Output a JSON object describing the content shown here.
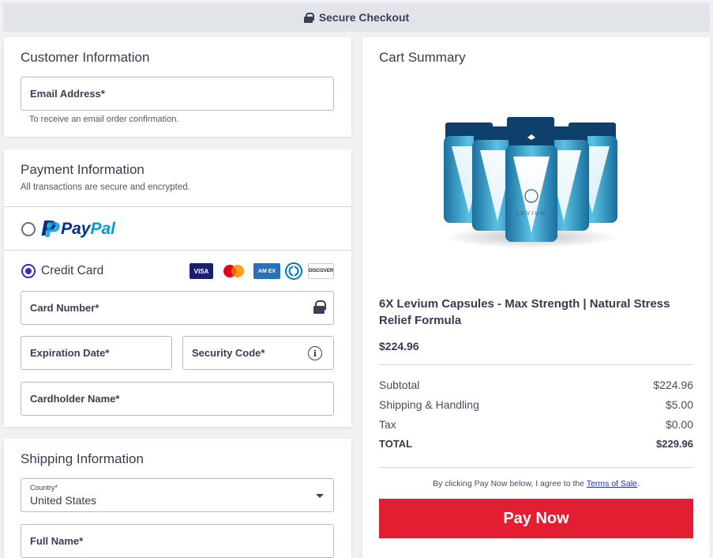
{
  "header": {
    "title": "Secure Checkout",
    "icon": "lock-icon"
  },
  "customer": {
    "title": "Customer Information",
    "email_label": "Email Address*",
    "email_hint": "To receive an email order confirmation."
  },
  "payment": {
    "title": "Payment Information",
    "subtitle": "All transactions are secure and encrypted.",
    "options": [
      {
        "id": "paypal",
        "label": "PayPal",
        "selected": false
      },
      {
        "id": "credit-card",
        "label": "Credit Card",
        "selected": true
      }
    ],
    "card_brands": [
      "VISA",
      "mastercard",
      "AM EX",
      "diners",
      "DISCOVER"
    ],
    "card_number_label": "Card Number*",
    "expiration_label": "Expiration Date*",
    "security_code_label": "Security Code*",
    "cardholder_label": "Cardholder Name*"
  },
  "shipping": {
    "title": "Shipping Information",
    "country_label": "Country*",
    "country_value": "United States",
    "full_name_label": "Full Name*"
  },
  "cart": {
    "title": "Cart Summary",
    "product_name": "6X Levium Capsules - Max Strength | Natural Stress Relief Formula",
    "product_price": "$224.96",
    "product_brand_label": "LEVIUM",
    "rows": [
      {
        "label": "Subtotal",
        "value": "$224.96"
      },
      {
        "label": "Shipping & Handling",
        "value": "$5.00"
      },
      {
        "label": "Tax",
        "value": "$0.00"
      },
      {
        "label": "TOTAL",
        "value": "$229.96"
      }
    ],
    "terms_prefix": "By clicking Pay Now below, I agree to the ",
    "terms_link": "Terms of Sale",
    "terms_suffix": ".",
    "pay_button": "Pay Now"
  },
  "colors": {
    "accent": "#2f2fb8",
    "pay_button": "#e31e33",
    "paypal_dark": "#003087",
    "paypal_light": "#009cde"
  }
}
